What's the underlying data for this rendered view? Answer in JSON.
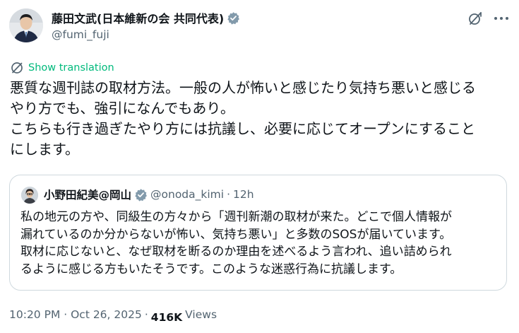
{
  "author": {
    "name": "藤田文武(日本維新の会 共同代表)",
    "handle": "@fumi_fuji",
    "verified_badge_color": "#829aab"
  },
  "actions": {
    "grok_icon": "grok-icon",
    "more_icon": "more-icon"
  },
  "translate": {
    "label": "Show translation",
    "color": "#00ba7c"
  },
  "tweet": {
    "lines": [
      "悪質な週刊誌の取材方法。一般の人が怖いと感じたり気持ち悪いと感じる",
      "やり方でも、強引になんでもあり。",
      "こちらも行き過ぎたやり方には抗議し、必要に応じてオープンにすること",
      "にします。"
    ]
  },
  "quote": {
    "name": "小野田紀美@岡山",
    "handle": "@onoda_kimi",
    "separator": "·",
    "time": "12h",
    "lines": [
      "私の地元の方や、同級生の方々から「週刊新潮の取材が来た。どこで個人情報が",
      "漏れているのか分からないが怖い、気持ち悪い」と多数のSOSが届いています。",
      "取材に応じないと、なぜ取材を断るのか理由を述べるよう言われ、追い詰められ",
      "るように感じる方もいたそうです。このような迷惑行為に抗議します。"
    ]
  },
  "meta": {
    "time": "10:20 PM · Oct 26, 2025",
    "dot": "·",
    "views_count": "416K",
    "views_label": "Views"
  }
}
